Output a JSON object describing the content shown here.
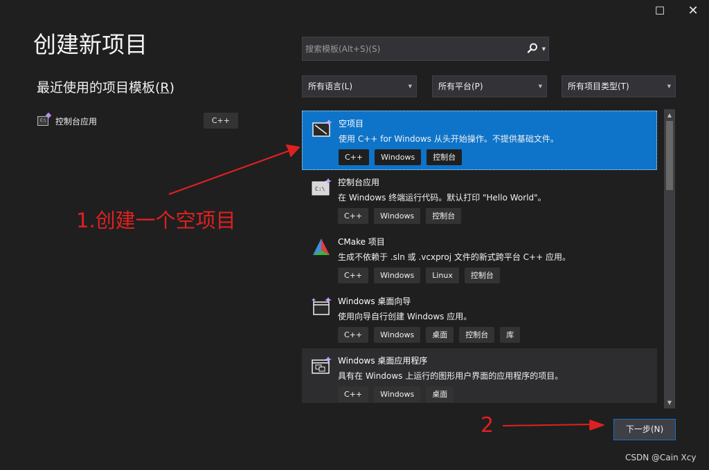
{
  "window": {
    "maximize_glyph": "☐",
    "close_glyph": "✕"
  },
  "header": {
    "title": "创建新项目"
  },
  "recent": {
    "title_prefix": "最近使用的项目模板(",
    "title_mnemonic": "R",
    "title_suffix": ")",
    "items": [
      {
        "icon": "console-app-icon",
        "label": "控制台应用",
        "badge": "C++"
      }
    ]
  },
  "search": {
    "placeholder": "搜索模板(Alt+S)(S)",
    "value": ""
  },
  "filters": {
    "language": "所有语言(L)",
    "platform": "所有平台(P)",
    "project_type": "所有项目类型(T)"
  },
  "templates": [
    {
      "icon": "empty-project-icon",
      "title": "空项目",
      "description": "使用 C++ for Windows 从头开始操作。不提供基础文件。",
      "tags": [
        "C++",
        "Windows",
        "控制台"
      ],
      "state": "selected"
    },
    {
      "icon": "console-app-icon",
      "title": "控制台应用",
      "description": "在 Windows 终端运行代码。默认打印 \"Hello World\"。",
      "tags": [
        "C++",
        "Windows",
        "控制台"
      ],
      "state": "normal"
    },
    {
      "icon": "cmake-icon",
      "title": "CMake 项目",
      "description": "生成不依赖于 .sln 或 .vcxproj 文件的新式跨平台 C++ 应用。",
      "tags": [
        "C++",
        "Windows",
        "Linux",
        "控制台"
      ],
      "state": "normal"
    },
    {
      "icon": "windows-wizard-icon",
      "title": "Windows 桌面向导",
      "description": "使用向导自行创建 Windows 应用。",
      "tags": [
        "C++",
        "Windows",
        "桌面",
        "控制台",
        "库"
      ],
      "state": "normal"
    },
    {
      "icon": "windows-desktop-app-icon",
      "title": "Windows 桌面应用程序",
      "description": "具有在 Windows 上运行的图形用户界面的应用程序的项目。",
      "tags": [
        "C++",
        "Windows",
        "桌面"
      ],
      "state": "hover"
    }
  ],
  "footer": {
    "next_label": "下一步(N)"
  },
  "annotations": {
    "step1": "1.创建一个空项目",
    "step2": "2",
    "color": "#e02020"
  },
  "watermark": "CSDN @Cain Xcy",
  "colors": {
    "background": "#1f1f1f",
    "accent": "#0e74c9",
    "panel": "#333337"
  }
}
